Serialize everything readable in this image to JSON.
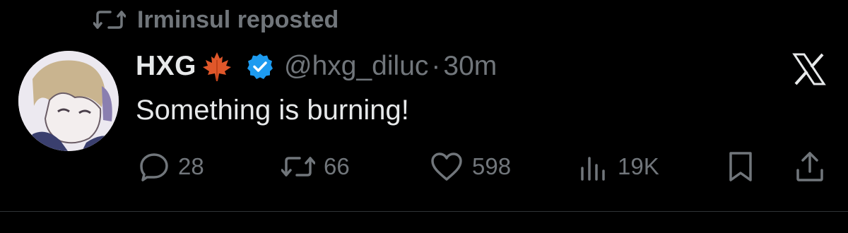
{
  "repost": {
    "label": "Irminsul reposted",
    "icon": "repost-icon"
  },
  "tweet": {
    "display_name": "HXG",
    "name_emoji": "maple-leaf-icon",
    "verified": true,
    "verified_color": "#1d9bf0",
    "handle": "@hxg_diluc",
    "separator": "·",
    "time": "30m",
    "text": "Something is burning!"
  },
  "actions": {
    "replies": "28",
    "reposts": "66",
    "likes": "598",
    "views": "19K"
  },
  "colors": {
    "background": "#000000",
    "text_primary": "#e7e9ea",
    "text_secondary": "#71767b",
    "divider": "#2f3336"
  }
}
